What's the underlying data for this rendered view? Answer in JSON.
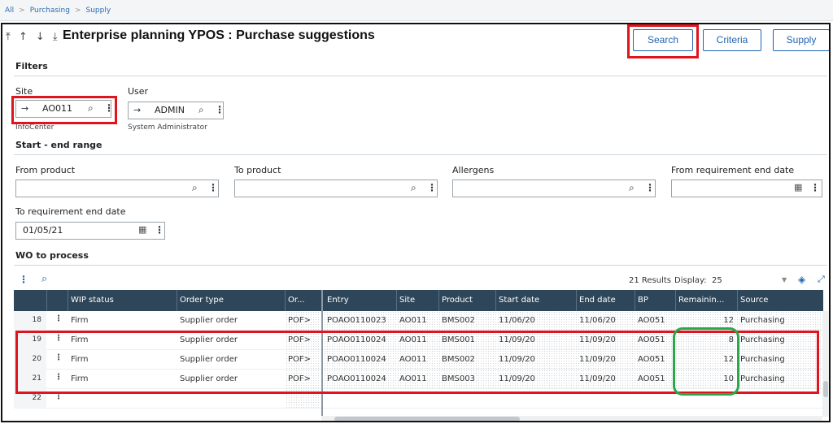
{
  "breadcrumb": {
    "items": [
      "All",
      "Purchasing",
      "Supply"
    ],
    "separator": ">"
  },
  "header": {
    "nav_arrows": "⤒ ↑ ↓ ⤓",
    "title": "Enterprise planning YPOS : Purchase suggestions",
    "buttons": {
      "search": "Search",
      "criteria": "Criteria",
      "supply": "Supply"
    }
  },
  "filters": {
    "section_title": "Filters",
    "site": {
      "label": "Site",
      "value": "AO011",
      "description": "InfoCenter"
    },
    "user": {
      "label": "User",
      "value": "ADMIN",
      "description": "System Administrator"
    },
    "range_title": "Start - end range",
    "from_product": {
      "label": "From product",
      "value": ""
    },
    "to_product": {
      "label": "To product",
      "value": ""
    },
    "allergens": {
      "label": "Allergens",
      "value": ""
    },
    "from_req_end_date": {
      "label": "From requirement end date",
      "value": ""
    },
    "to_req_end_date": {
      "label": "To requirement end date",
      "value": "01/05/21"
    }
  },
  "wo_section": {
    "title": "WO to process",
    "results": "21 Results",
    "display_label": "Display:",
    "display_value": "25"
  },
  "table": {
    "columns": [
      "WIP status",
      "Order type",
      "Or...",
      "Entry",
      "Site",
      "Product",
      "Start date",
      "End date",
      "BP",
      "Remainin...",
      "Source"
    ],
    "rows": [
      {
        "num": "18",
        "wip": "Firm",
        "otype": "Supplier order",
        "or": "POF>",
        "entry": "POAO0110023",
        "site": "AO011",
        "product": "BMS002",
        "start": "11/06/20",
        "end": "11/06/20",
        "bp": "AO051",
        "remaining": "12",
        "source": "Purchasing"
      },
      {
        "num": "19",
        "wip": "Firm",
        "otype": "Supplier order",
        "or": "POF>",
        "entry": "POAO0110024",
        "site": "AO011",
        "product": "BMS001",
        "start": "11/09/20",
        "end": "11/09/20",
        "bp": "AO051",
        "remaining": "8",
        "source": "Purchasing"
      },
      {
        "num": "20",
        "wip": "Firm",
        "otype": "Supplier order",
        "or": "POF>",
        "entry": "POAO0110024",
        "site": "AO011",
        "product": "BMS002",
        "start": "11/09/20",
        "end": "11/09/20",
        "bp": "AO051",
        "remaining": "12",
        "source": "Purchasing"
      },
      {
        "num": "21",
        "wip": "Firm",
        "otype": "Supplier order",
        "or": "POF>",
        "entry": "POAO0110024",
        "site": "AO011",
        "product": "BMS003",
        "start": "11/09/20",
        "end": "11/09/20",
        "bp": "AO051",
        "remaining": "10",
        "source": "Purchasing"
      },
      {
        "num": "22",
        "wip": "",
        "otype": "",
        "or": "",
        "entry": "",
        "site": "",
        "product": "",
        "start": "",
        "end": "",
        "bp": "",
        "remaining": "",
        "source": ""
      }
    ]
  },
  "icons": {
    "search": "search-icon",
    "more": "more-vertical-icon",
    "calendar": "calendar-icon",
    "arrow": "arrow-right-icon",
    "layers": "layers-icon",
    "expand": "expand-icon"
  },
  "colors": {
    "accent": "#1f64b0",
    "header_bg": "#2e4659",
    "highlight_red": "#e0141c",
    "highlight_green": "#2aa84a"
  }
}
